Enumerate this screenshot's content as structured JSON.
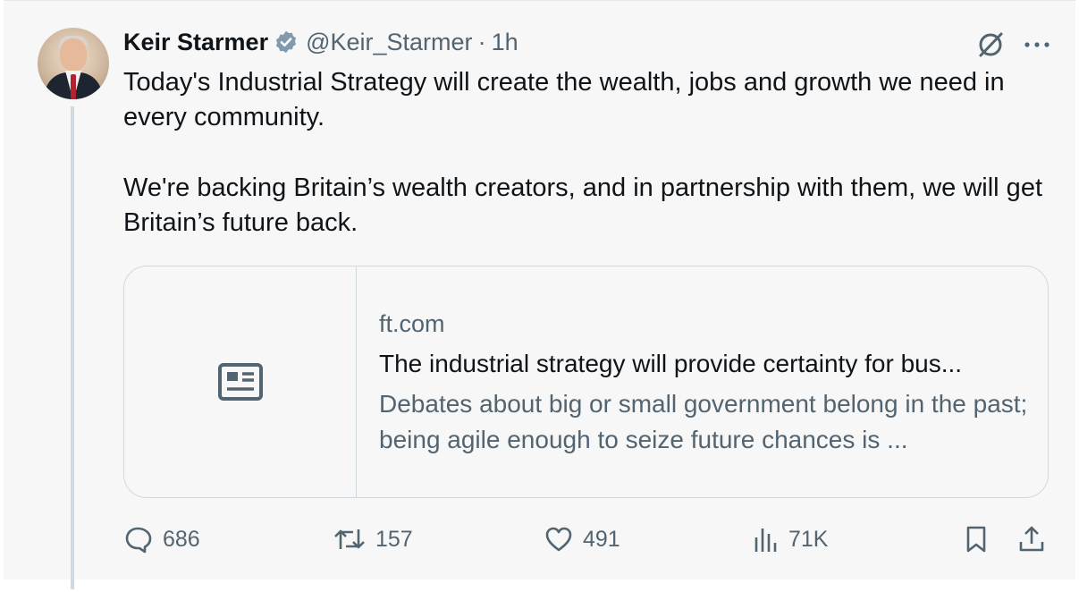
{
  "tweet": {
    "author": {
      "name": "Keir Starmer",
      "handle": "@Keir_Starmer",
      "separator": "·",
      "time": "1h"
    },
    "text_paragraph_1": "Today's Industrial Strategy will create the wealth, jobs and growth we need in every community.",
    "text_paragraph_2": "We're backing Britain’s wealth creators, and in partnership with them, we will get Britain’s future back.",
    "card": {
      "domain": "ft.com",
      "title": "The industrial strategy will provide certainty for bus...",
      "description": "Debates about big or small government belong in the past; being agile enough to seize future chances is ...",
      "thumbnail_icon": "article-icon"
    },
    "actions": {
      "replies": "686",
      "reposts": "157",
      "likes": "491",
      "views": "71K"
    }
  },
  "icons": {
    "verified": "verified-badge-icon",
    "grok": "grok-icon",
    "more": "more-icon",
    "reply": "reply-icon",
    "repost": "repost-icon",
    "like": "like-icon",
    "views": "views-icon",
    "bookmark": "bookmark-icon",
    "share": "share-icon"
  },
  "colors": {
    "text_primary": "#0f1419",
    "text_secondary": "#536471",
    "border": "#cfd9de",
    "verified_badge": "#829aab"
  }
}
